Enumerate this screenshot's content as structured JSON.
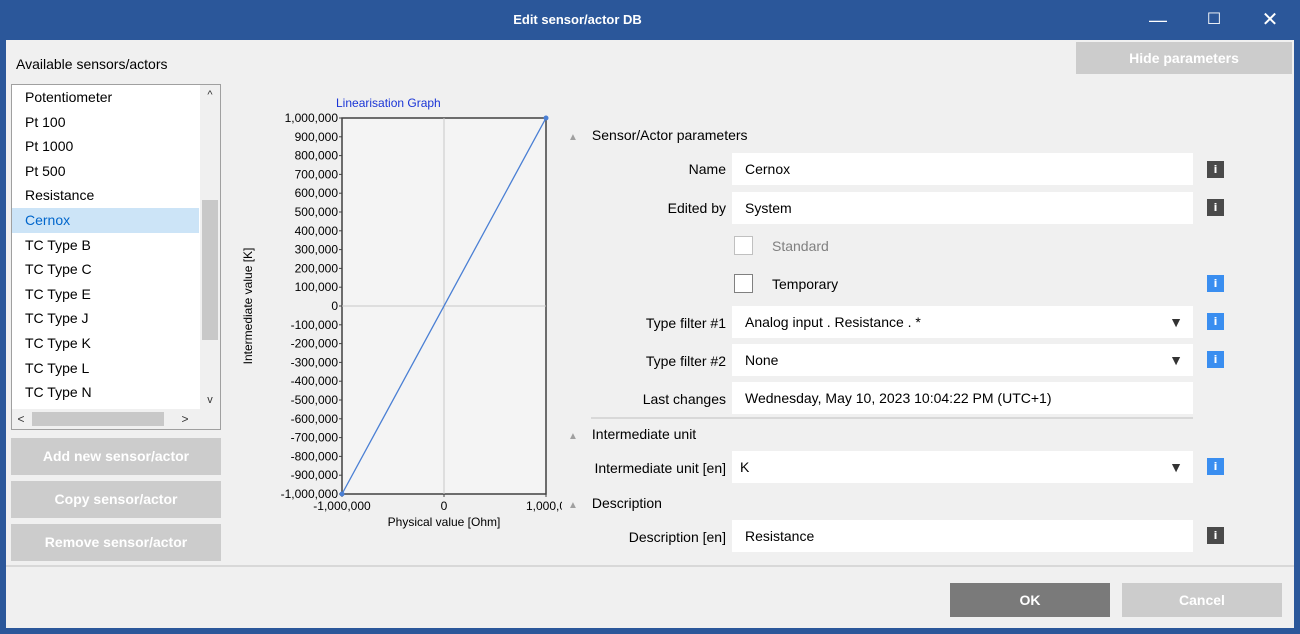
{
  "window": {
    "title": "Edit sensor/actor DB",
    "minimize_glyph": "—",
    "maximize_glyph": "☐",
    "close_glyph": "✕"
  },
  "left_panel": {
    "title": "Available sensors/actors",
    "items": [
      "Potentiometer",
      "Pt 100",
      "Pt 1000",
      "Pt 500",
      "Resistance",
      "Cernox",
      "TC Type B",
      "TC Type C",
      "TC Type E",
      "TC Type J",
      "TC Type K",
      "TC Type L",
      "TC Type N"
    ],
    "selected": "Cernox",
    "scroll_up": "^",
    "scroll_down": "v",
    "scroll_left": "<",
    "scroll_right": ">",
    "add_button": "Add new sensor/actor",
    "copy_button": "Copy sensor/actor",
    "remove_button": "Remove sensor/actor"
  },
  "hide_parameters_button": "Hide parameters",
  "chart_data": {
    "type": "line",
    "title": "Linearisation Graph",
    "xlabel": "Physical value [Ohm]",
    "ylabel": "Intermediate value [K]",
    "x": [
      -1000000,
      1000000
    ],
    "y": [
      -1000000,
      1000000
    ],
    "xlim": [
      -1000000,
      1000000
    ],
    "ylim": [
      -1000000,
      1000000
    ],
    "x_ticks": [
      "-1,000,000",
      "0",
      "1,000,0"
    ],
    "y_ticks": [
      "1,000,000",
      "900,000",
      "800,000",
      "700,000",
      "600,000",
      "500,000",
      "400,000",
      "300,000",
      "200,000",
      "100,000",
      "0",
      "-100,000",
      "-200,000",
      "-300,000",
      "-400,000",
      "-500,000",
      "-600,000",
      "-700,000",
      "-800,000",
      "-900,000",
      "-1,000,000"
    ],
    "grid": true,
    "line_color": "#4a7fd4"
  },
  "params": {
    "section_sensor": "Sensor/Actor parameters",
    "name_label": "Name",
    "name_value": "Cernox",
    "edited_by_label": "Edited by",
    "edited_by_value": "System",
    "standard_label": "Standard",
    "temporary_label": "Temporary",
    "type_filter1_label": "Type filter #1",
    "type_filter1_value": "Analog input . Resistance . *",
    "type_filter2_label": "Type filter #2",
    "type_filter2_value": "None",
    "last_changes_label": "Last changes",
    "last_changes_value": "Wednesday, May 10, 2023   10:04:22 PM (UTC+1)",
    "section_intermediate": "Intermediate unit",
    "intermediate_unit_label": "Intermediate unit [en]",
    "intermediate_unit_value": "K",
    "section_description": "Description",
    "description_label": "Description [en]",
    "description_value": "Resistance",
    "info_glyph": "i",
    "dropdown_glyph": "▼",
    "collapse_glyph": "▲"
  },
  "footer": {
    "ok": "OK",
    "cancel": "Cancel"
  },
  "colors": {
    "titlebar": "#2b579a",
    "info_gray": "#4a4a4a",
    "info_blue": "#3a8ef0",
    "selected_bg": "#cce4f7",
    "selected_text": "#0066cc"
  }
}
